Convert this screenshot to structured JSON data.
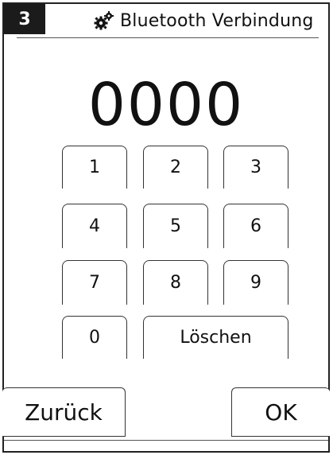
{
  "header": {
    "step": "3",
    "title": "Bluetooth Verbindung",
    "icon": "gears-icon"
  },
  "pin": {
    "value": "0000"
  },
  "keypad": {
    "keys": [
      "1",
      "2",
      "3",
      "4",
      "5",
      "6",
      "7",
      "8",
      "9",
      "0"
    ],
    "delete_label": "Löschen"
  },
  "footer": {
    "back_label": "Zurück",
    "ok_label": "OK"
  },
  "colors": {
    "badge_bg": "#1b1b1b",
    "border": "#333333",
    "background": "#ffffff"
  }
}
